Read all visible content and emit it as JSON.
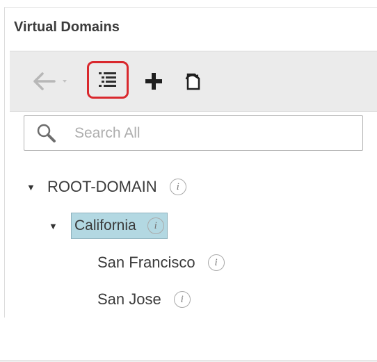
{
  "panel": {
    "title": "Virtual Domains"
  },
  "toolbar": {
    "back_icon": "back-arrow-icon",
    "dropdown_icon": "chevron-down-icon",
    "list_icon": "list-view-icon",
    "add_icon": "plus-icon",
    "refresh_icon": "refresh-icon",
    "highlight_color": "#d9282d"
  },
  "search": {
    "placeholder": "Search All",
    "value": ""
  },
  "tree": {
    "root": {
      "label": "ROOT-DOMAIN",
      "expanded": true,
      "info": "i"
    },
    "children": [
      {
        "label": "California",
        "expanded": true,
        "selected": true,
        "info": "i",
        "children": [
          {
            "label": "San Francisco",
            "info": "i"
          },
          {
            "label": "San Jose",
            "info": "i"
          }
        ]
      }
    ],
    "selection_color": "#b3d8e2"
  }
}
